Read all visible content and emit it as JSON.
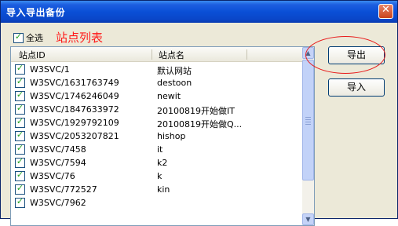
{
  "window": {
    "title": "导入导出备份",
    "close_glyph": "✕"
  },
  "select_all": {
    "label": "全选",
    "checked": true
  },
  "list_title": "站点列表",
  "list": {
    "columns": [
      "站点ID",
      "站点名"
    ],
    "rows": [
      {
        "id": "W3SVC/1",
        "name": "默认网站",
        "checked": true
      },
      {
        "id": "W3SVC/1631763749",
        "name": "destoon",
        "checked": true
      },
      {
        "id": "W3SVC/1746246049",
        "name": "newit",
        "checked": true
      },
      {
        "id": "W3SVC/1847633972",
        "name": "20100819开始做IT",
        "checked": true
      },
      {
        "id": "W3SVC/1929792109",
        "name": "20100819开始做Q...",
        "checked": true
      },
      {
        "id": "W3SVC/2053207821",
        "name": "hishop",
        "checked": true
      },
      {
        "id": "W3SVC/7458",
        "name": "it",
        "checked": true
      },
      {
        "id": "W3SVC/7594",
        "name": "k2",
        "checked": true
      },
      {
        "id": "W3SVC/76",
        "name": "k",
        "checked": true
      },
      {
        "id": "W3SVC/772527",
        "name": "kin",
        "checked": true
      },
      {
        "id": "W3SVC/7962",
        "name": "",
        "checked": true
      }
    ]
  },
  "buttons": {
    "export": "导出",
    "import": "导入"
  },
  "colors": {
    "annotation": "#e81b1b",
    "titlebar": "#0a4fd6",
    "check": "#21a121"
  }
}
